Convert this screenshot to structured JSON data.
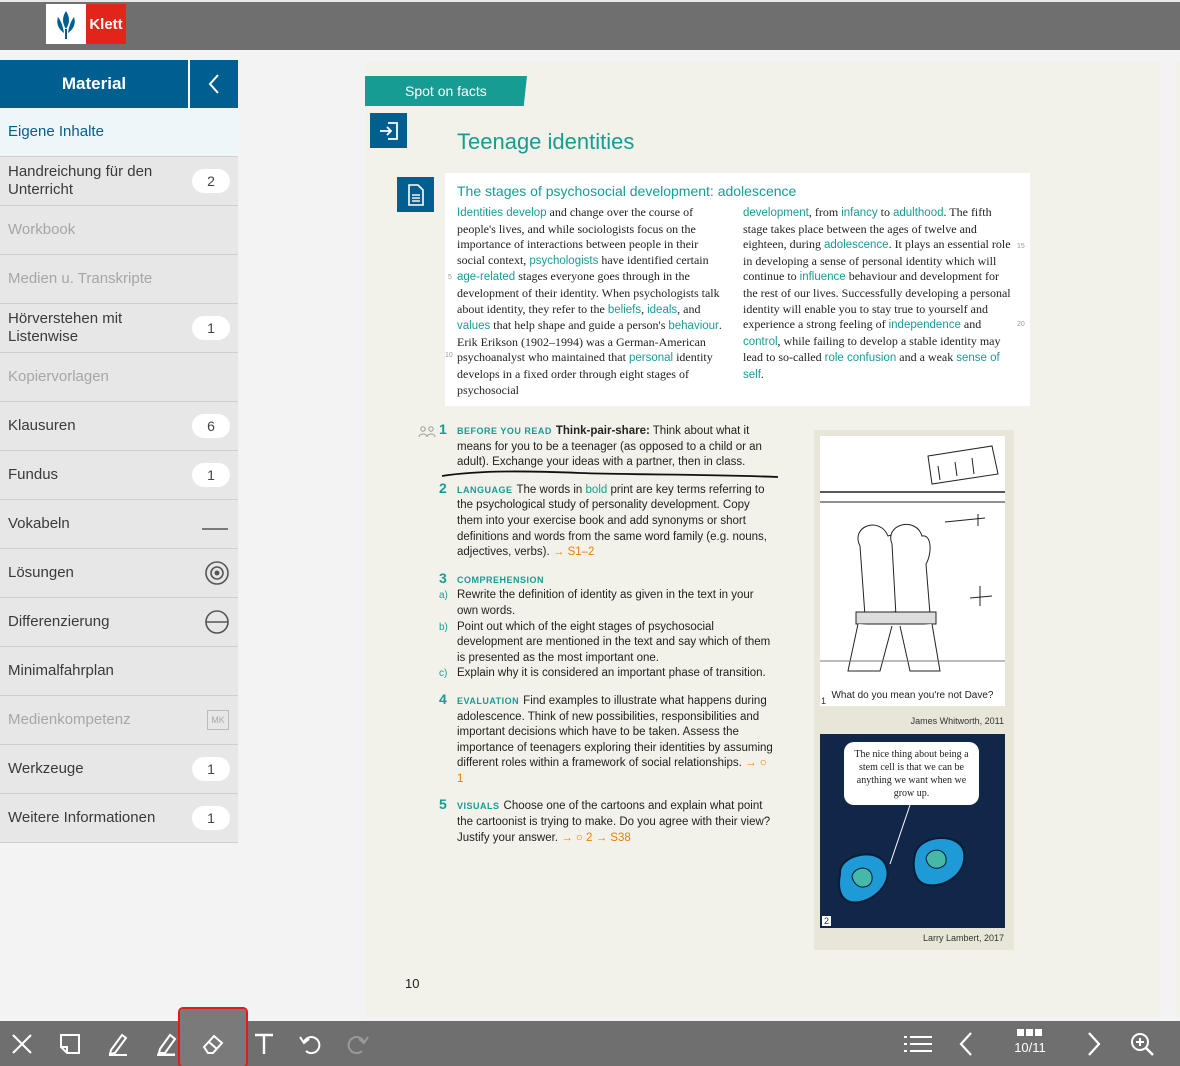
{
  "header": {
    "brand": "Klett"
  },
  "sidebar": {
    "title": "Material",
    "items": [
      {
        "label": "Eigene Inhalte",
        "badge": ""
      },
      {
        "label": "Handreichung für den Unterricht",
        "badge": "2"
      },
      {
        "label": "Workbook",
        "badge": ""
      },
      {
        "label": "Medien u. Transkripte",
        "badge": ""
      },
      {
        "label": "Hörverstehen mit Listenwise",
        "badge": "1"
      },
      {
        "label": "Kopiervorlagen",
        "badge": ""
      },
      {
        "label": "Klausuren",
        "badge": "6"
      },
      {
        "label": "Fundus",
        "badge": "1"
      },
      {
        "label": "Vokabeln",
        "badge": ""
      },
      {
        "label": "Lösungen",
        "badge": ""
      },
      {
        "label": "Differenzierung",
        "badge": ""
      },
      {
        "label": "Minimalfahrplan",
        "badge": ""
      },
      {
        "label": "Medienkompetenz",
        "badge": "MK"
      },
      {
        "label": "Werkzeuge",
        "badge": "1"
      },
      {
        "label": "Weitere Informationen",
        "badge": "1"
      }
    ]
  },
  "page": {
    "banner": "Spot on facts",
    "title": "Teenage identities",
    "box_title": "The stages of psychosocial development: adolescence",
    "col1": {
      "a1": "Identities develop",
      "a2": " and change over the course of people's lives, and while sociologists focus on the importance of interactions between people in their social context, ",
      "a3": "psychologists",
      "a4": " have identified certain ",
      "a5": "age-related",
      "a6": " stages everyone goes through in the development of their identity. When psychologists talk about identity, they refer to the ",
      "a7": "beliefs",
      "a8": ", ",
      "a9": "ideals",
      "a10": ", and ",
      "a11": "values",
      "a12": " that help shape and guide a person's ",
      "a13": "behaviour",
      "a14": ". Erik Erikson (1902–1994) was a German-American psychoanalyst who maintained that ",
      "a15": "personal",
      "a16": " identity develops in a fixed order through eight stages of psychosocial"
    },
    "col2": {
      "b1": "development",
      "b2": ", from ",
      "b3": "infancy",
      "b4": " to ",
      "b5": "adulthood",
      "b6": ". The fifth stage takes place between the ages of twelve and eighteen, during ",
      "b7": "adolescence",
      "b8": ". It plays an essential role in developing a sense of personal identity which will continue to ",
      "b9": "influence",
      "b10": " behaviour and development for the rest of our lives. Successfully developing a personal identity will enable you to stay true to yourself and experience a strong feeling of ",
      "b11": "independence",
      "b12": " and ",
      "b13": "control",
      "b14": ", while failing to develop a stable identity may lead to so-called ",
      "b15": "role confusion",
      "b16": " and a weak ",
      "b17": "sense of self",
      "b18": "."
    },
    "line_numbers": [
      "5",
      "10",
      "15",
      "20"
    ],
    "tasks": [
      {
        "num": "1",
        "kw": "BEFORE YOU READ",
        "bold": "Think-pair-share:",
        "text": " Think about what it means for you to be a teenager (as opposed to a child or an adult). Exchange your ideas with a partner, then in class."
      },
      {
        "num": "2",
        "kw": "LANGUAGE",
        "pre": "The words in ",
        "bold": "bold",
        "text": " print are key terms referring to the psychological study of personality development. Copy them into your exercise book and add synonyms or short definitions and words from the same word family (e.g. nouns, adjectives, verbs). ",
        "ref": "→ S1–2"
      },
      {
        "num": "3",
        "kw": "COMPREHENSION",
        "subs": [
          {
            "letter": "a)",
            "text": "Rewrite the definition of identity as given in the text in your own words."
          },
          {
            "letter": "b)",
            "text": "Point out which of the eight stages of psychosocial development are mentioned in the text and say which of them is presented as the most important one."
          },
          {
            "letter": "c)",
            "text": "Explain why it is considered an important phase of transition."
          }
        ]
      },
      {
        "num": "4",
        "kw": "EVALUATION",
        "text": "Find examples to illustrate what happens during adolescence. Think of new possibilities, responsibilities and important decisions which have to be taken. Assess the importance of teenagers exploring their identities by assuming different roles within a framework of social relationships. ",
        "ref": "→ ○ 1"
      },
      {
        "num": "5",
        "kw": "VISUALS",
        "text": "Choose one of the cartoons and explain what point the cartoonist is trying to make. Do you agree with their view? Justify your answer. ",
        "ref": "→ ○ 2  → S38"
      }
    ],
    "cartoon1": {
      "num": "1",
      "caption": "What do you mean you're not Dave?",
      "credit": "James Whitworth, 2011"
    },
    "cartoon2": {
      "num": "2",
      "bubble": "The nice thing about being a stem cell is that we can be anything we want when we grow up.",
      "credit": "Larry Lambert, 2017"
    },
    "page_number": "10"
  },
  "toolbar": {
    "pager": "10/11"
  }
}
